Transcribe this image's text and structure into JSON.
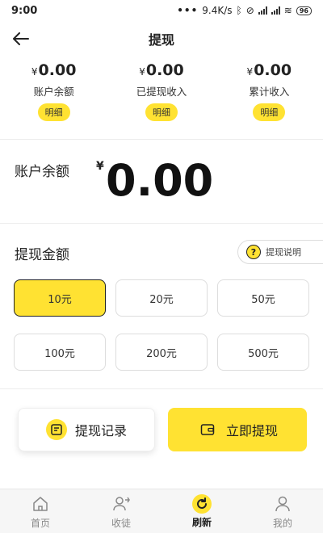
{
  "status_bar": {
    "time": "9:00",
    "dots": "•••",
    "speed": "9.4K/s",
    "battery": "96"
  },
  "header": {
    "title": "提现"
  },
  "summary": [
    {
      "currency": "¥",
      "value": "0.00",
      "label": "账户余额",
      "detail": "明细"
    },
    {
      "currency": "¥",
      "value": "0.00",
      "label": "已提现收入",
      "detail": "明细"
    },
    {
      "currency": "¥",
      "value": "0.00",
      "label": "累计收入",
      "detail": "明细"
    }
  ],
  "balance": {
    "label": "账户余额",
    "currency": "¥",
    "value": "0.00"
  },
  "amount": {
    "label": "提现金额",
    "help": "提现说明",
    "options": [
      "10元",
      "20元",
      "50元",
      "100元",
      "200元",
      "500元"
    ],
    "selected": "10元"
  },
  "actions": {
    "record": "提现记录",
    "withdraw": "立即提现"
  },
  "tabbar": {
    "items": [
      {
        "label": "首页",
        "icon": "home-icon"
      },
      {
        "label": "收徒",
        "icon": "add-user-icon"
      },
      {
        "label": "刷新",
        "icon": "refresh-icon"
      },
      {
        "label": "我的",
        "icon": "profile-icon"
      }
    ],
    "active": "刷新"
  },
  "colors": {
    "accent": "#ffe232",
    "text": "#222222"
  }
}
